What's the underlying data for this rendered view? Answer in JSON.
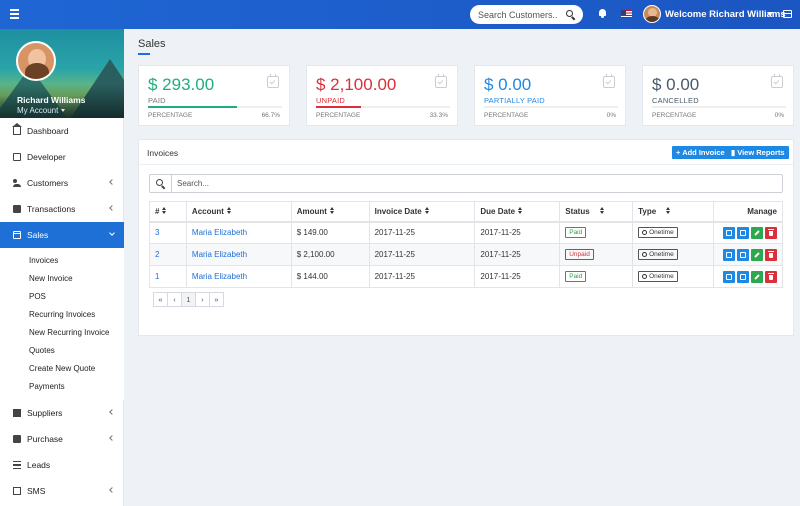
{
  "topbar": {
    "search_placeholder": "Search Customers...",
    "welcome_text": "Welcome Richard Williams"
  },
  "profile": {
    "name": "Richard Williams",
    "account_label": "My Account"
  },
  "nav": {
    "dashboard": "Dashboard",
    "developer": "Developer",
    "customers": "Customers",
    "transactions": "Transactions",
    "sales": "Sales",
    "sales_sub": [
      "Invoices",
      "New Invoice",
      "POS",
      "Recurring Invoices",
      "New Recurring Invoice",
      "Quotes",
      "Create New Quote",
      "Payments"
    ],
    "suppliers": "Suppliers",
    "purchase": "Purchase",
    "leads": "Leads",
    "sms": "SMS"
  },
  "page": {
    "title": "Sales"
  },
  "cards": [
    {
      "amount": "$ 293.00",
      "label": "PAID",
      "pct_label": "PERCENTAGE",
      "pct": "66.7%",
      "fill": 0.667,
      "color": "#1fae7e"
    },
    {
      "amount": "$ 2,100.00",
      "label": "UNPAID",
      "pct_label": "PERCENTAGE",
      "pct": "33.3%",
      "fill": 0.333,
      "color": "#d9303a"
    },
    {
      "amount": "$ 0.00",
      "label": "PARTIALLY PAID",
      "pct_label": "PERCENTAGE",
      "pct": "0%",
      "fill": 0,
      "color": "#1e88e5"
    },
    {
      "amount": "$ 0.00",
      "label": "CANCELLED",
      "pct_label": "PERCENTAGE",
      "pct": "0%",
      "fill": 0,
      "color": "#4a5a6a"
    }
  ],
  "invoices": {
    "title": "Invoices",
    "add_label": "Add Invoice",
    "reports_label": "View Reports",
    "search_placeholder": "Search...",
    "headers": [
      "#",
      "Account",
      "Amount",
      "Invoice Date",
      "Due Date",
      "Status",
      "Type",
      "Manage"
    ],
    "rows": [
      {
        "id": "3",
        "account": "Maria Elizabeth",
        "amount": "$ 149.00",
        "invoice_date": "2017-11-25",
        "due_date": "2017-11-25",
        "status": "Paid",
        "type": "Onetime"
      },
      {
        "id": "2",
        "account": "Maria Elizabeth",
        "amount": "$ 2,100.00",
        "invoice_date": "2017-11-25",
        "due_date": "2017-11-25",
        "status": "Unpaid",
        "type": "Onetime"
      },
      {
        "id": "1",
        "account": "Maria Elizabeth",
        "amount": "$ 144.00",
        "invoice_date": "2017-11-25",
        "due_date": "2017-11-25",
        "status": "Paid",
        "type": "Onetime"
      }
    ],
    "pager": [
      "«",
      "‹",
      "1",
      "›",
      "»"
    ]
  },
  "colors": {
    "primary": "#1e6fd6",
    "topbar": "#1f66d4",
    "paid": "#2e9d4a",
    "unpaid": "#d9303a"
  }
}
